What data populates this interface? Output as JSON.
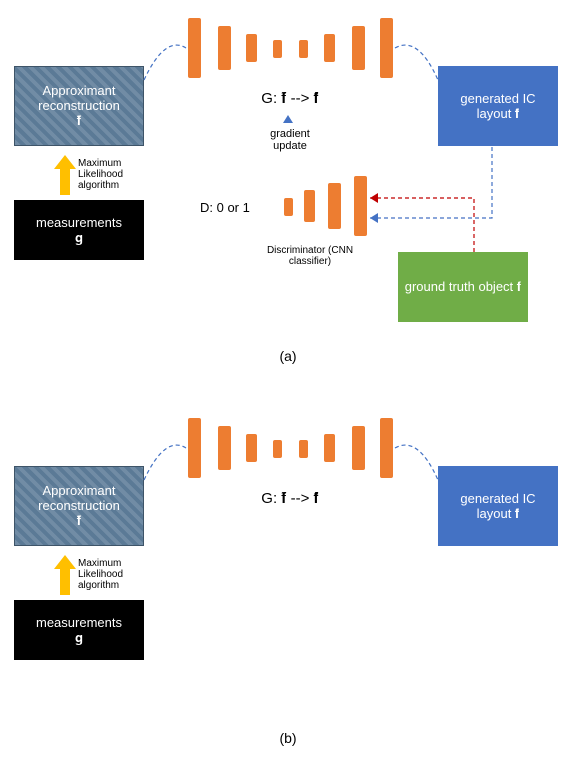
{
  "panelA": {
    "approx_box": "Approximant reconstruction\n𝐟̃",
    "measurements": "measurements\n𝐠",
    "ml_label": "Maximum Likelihood algorithm",
    "generator_label": "G:  𝐟̃ --> 𝐟̂",
    "gradient_label": "gradient update",
    "generated_box": "generated IC\nlayout 𝐟̂",
    "discriminator_label": "D: 0 or 1",
    "discriminator_caption": "Discriminator (CNN classifier)",
    "ground_truth_box": "ground truth object 𝐟",
    "caption": "(a)"
  },
  "panelB": {
    "approx_box": "Approximant reconstruction\n𝐟̃",
    "measurements": "measurements\n𝐠",
    "ml_label": "Maximum Likelihood algorithm",
    "generator_label": "G:  𝐟̃ --> 𝐟̂",
    "generated_box": "generated IC\nlayout 𝐟̂",
    "caption": "(b)"
  }
}
